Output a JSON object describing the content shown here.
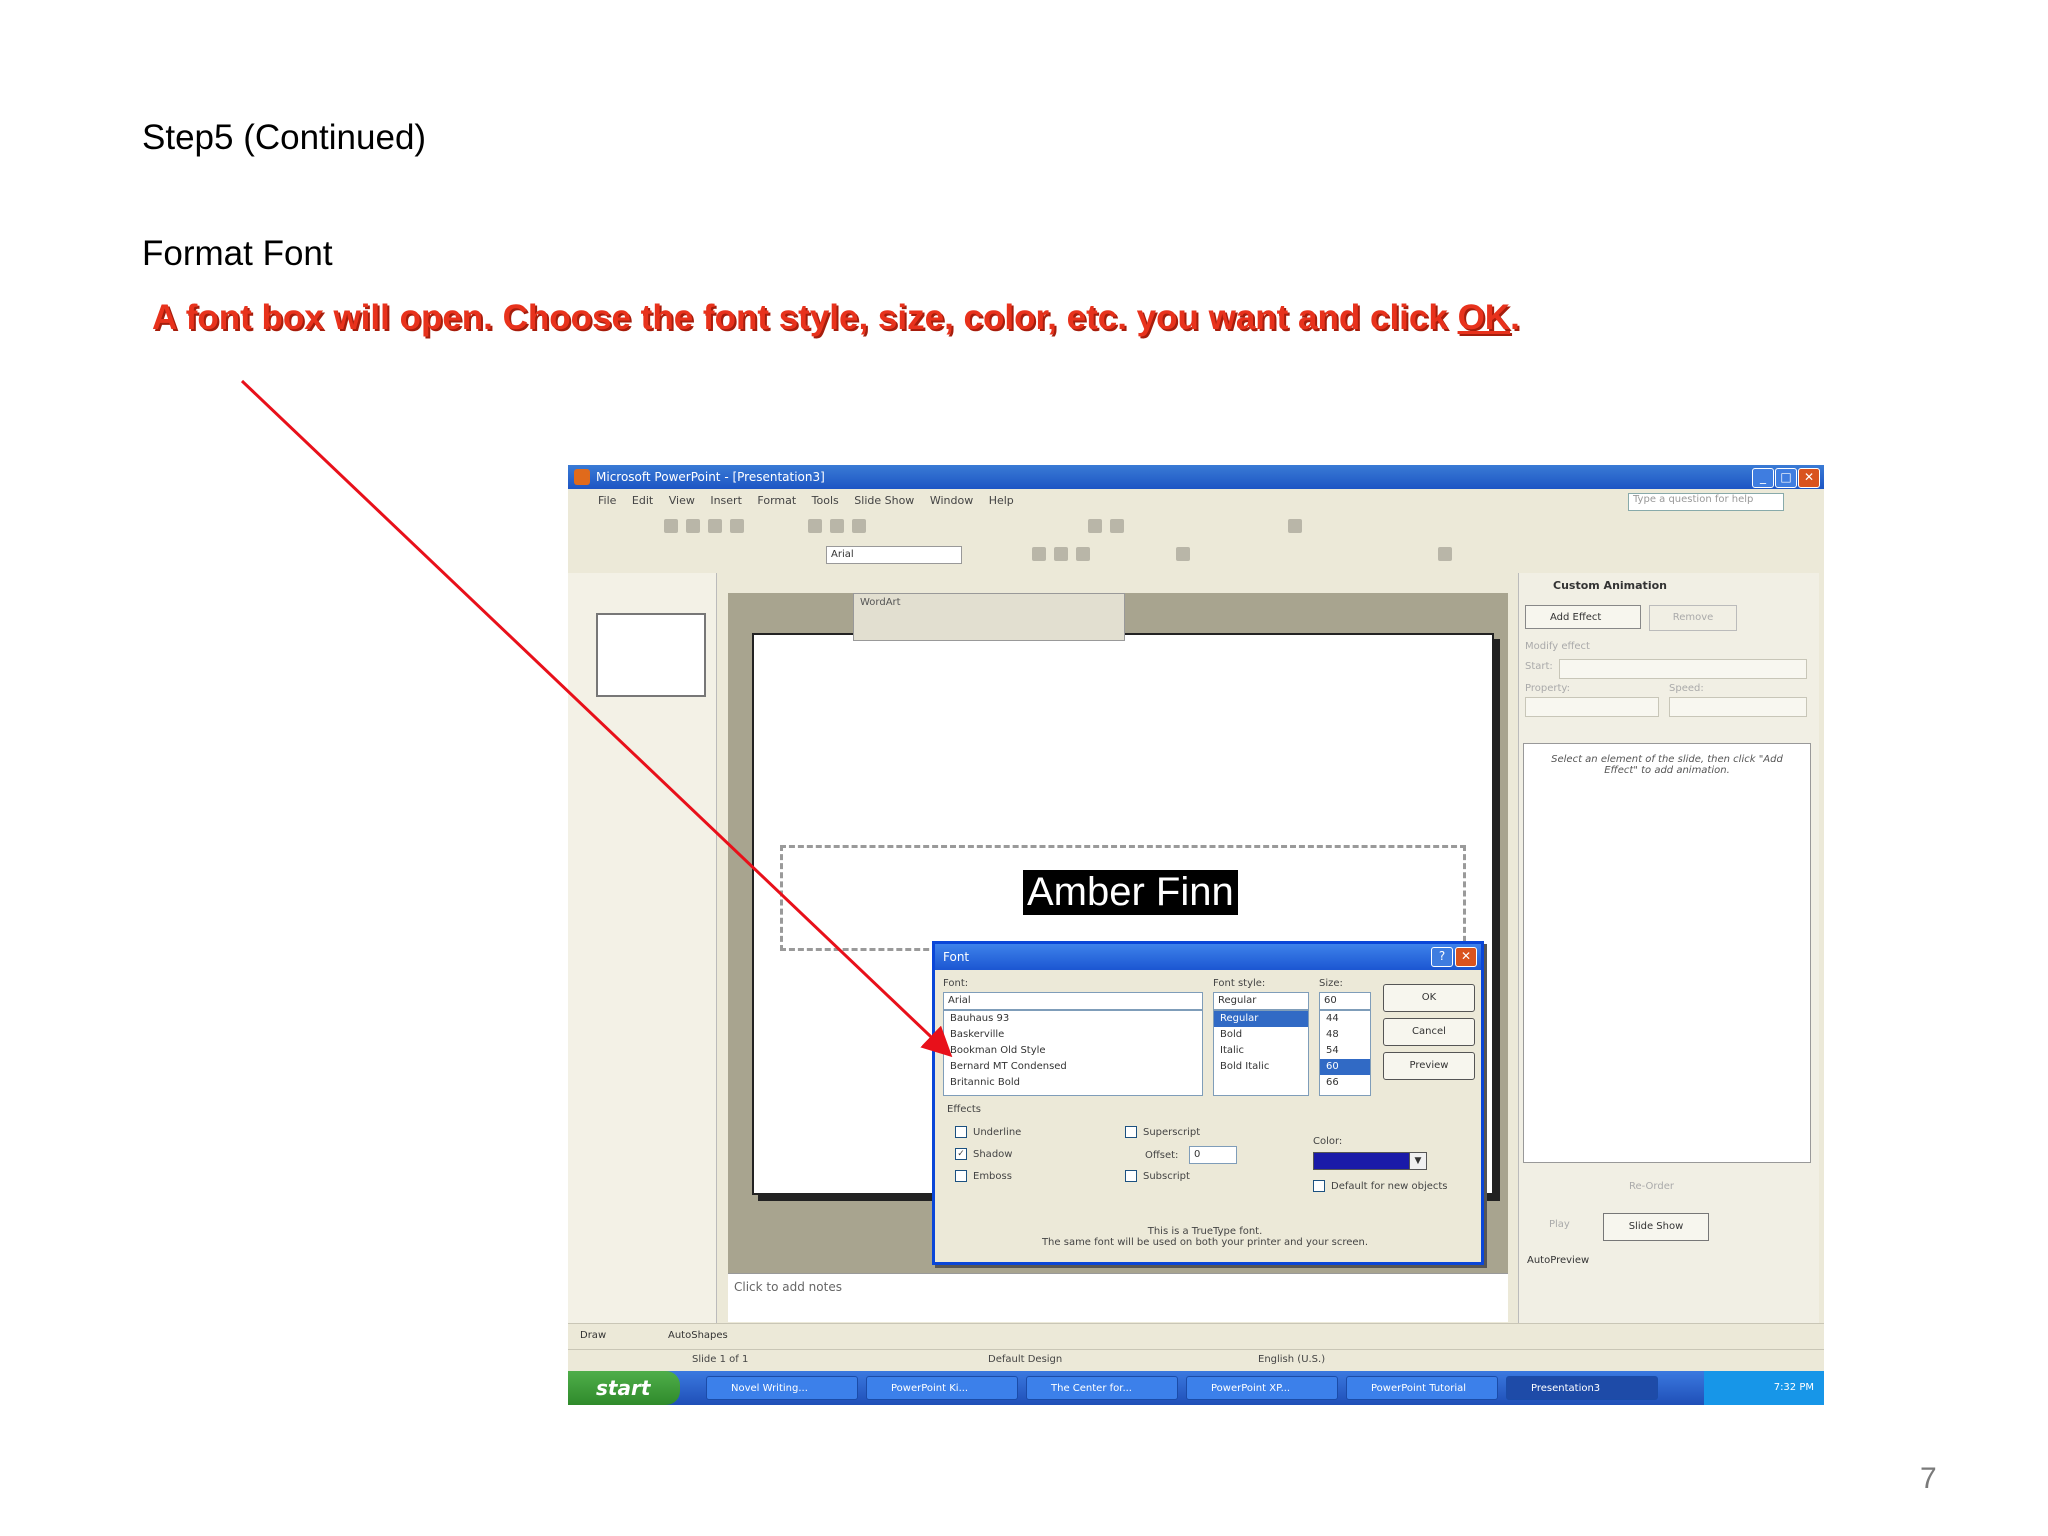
{
  "slide": {
    "step_heading": "Step5 (Continued)",
    "subheading": "Format Font",
    "instruction_prefix": "A font box will open. Choose the font style, size, color, etc. you want and click ",
    "instruction_ok": "OK",
    "instruction_suffix": ".",
    "page_number": "7",
    "accent_color": "#e8321c"
  },
  "screenshot": {
    "title": "Microsoft PowerPoint - [Presentation3]",
    "menu": [
      "File",
      "Edit",
      "View",
      "Insert",
      "Format",
      "Tools",
      "Slide Show",
      "Window",
      "Help"
    ],
    "help_placeholder": "Type a question for help",
    "font_name": "Arial",
    "wordart_title": "WordArt",
    "slide_text": "Amber Finn",
    "notes_placeholder": "Click to add notes",
    "task_pane": {
      "title": "Custom Animation",
      "add_effect": "Add Effect",
      "remove": "Remove",
      "modify_label": "Modify effect",
      "start_label": "Start:",
      "property_label": "Property:",
      "speed_label": "Speed:",
      "hint": "Select an element of the slide, then click \"Add Effect\" to add animation.",
      "reorder": "Re-Order",
      "play": "Play",
      "slide_show": "Slide Show",
      "autopreview": "AutoPreview"
    },
    "draw_bar": {
      "draw": "Draw",
      "autoshapes": "AutoShapes"
    },
    "status": {
      "slide": "Slide 1 of 1",
      "design": "Default Design",
      "language": "English (U.S.)"
    },
    "taskbar": {
      "start": "start",
      "tasks": [
        "Novel Writing...",
        "PowerPoint Ki...",
        "The Center for...",
        "PowerPoint XP...",
        "PowerPoint Tutorial",
        "Presentation3"
      ],
      "clock": "7:32 PM"
    },
    "font_dialog": {
      "title": "Font",
      "font_label": "Font:",
      "font_value": "Arial",
      "font_list": [
        "Bauhaus 93",
        "Baskerville",
        "Bookman Old Style",
        "Bernard MT Condensed",
        "Britannic Bold"
      ],
      "style_label": "Font style:",
      "style_value": "Regular",
      "style_list": [
        "Regular",
        "Bold",
        "Italic",
        "Bold Italic"
      ],
      "size_label": "Size:",
      "size_value": "60",
      "size_list": [
        "44",
        "48",
        "54",
        "60",
        "66"
      ],
      "ok": "OK",
      "cancel": "Cancel",
      "preview": "Preview",
      "effects_label": "Effects",
      "underline": "Underline",
      "shadow": "Shadow",
      "emboss": "Emboss",
      "superscript": "Superscript",
      "offset_label": "Offset:",
      "offset_value": "0",
      "subscript": "Subscript",
      "color_label": "Color:",
      "default_label": "Default for new objects",
      "note_line1": "This is a TrueType font.",
      "note_line2": "The same font will be used on both your printer and your screen."
    }
  }
}
